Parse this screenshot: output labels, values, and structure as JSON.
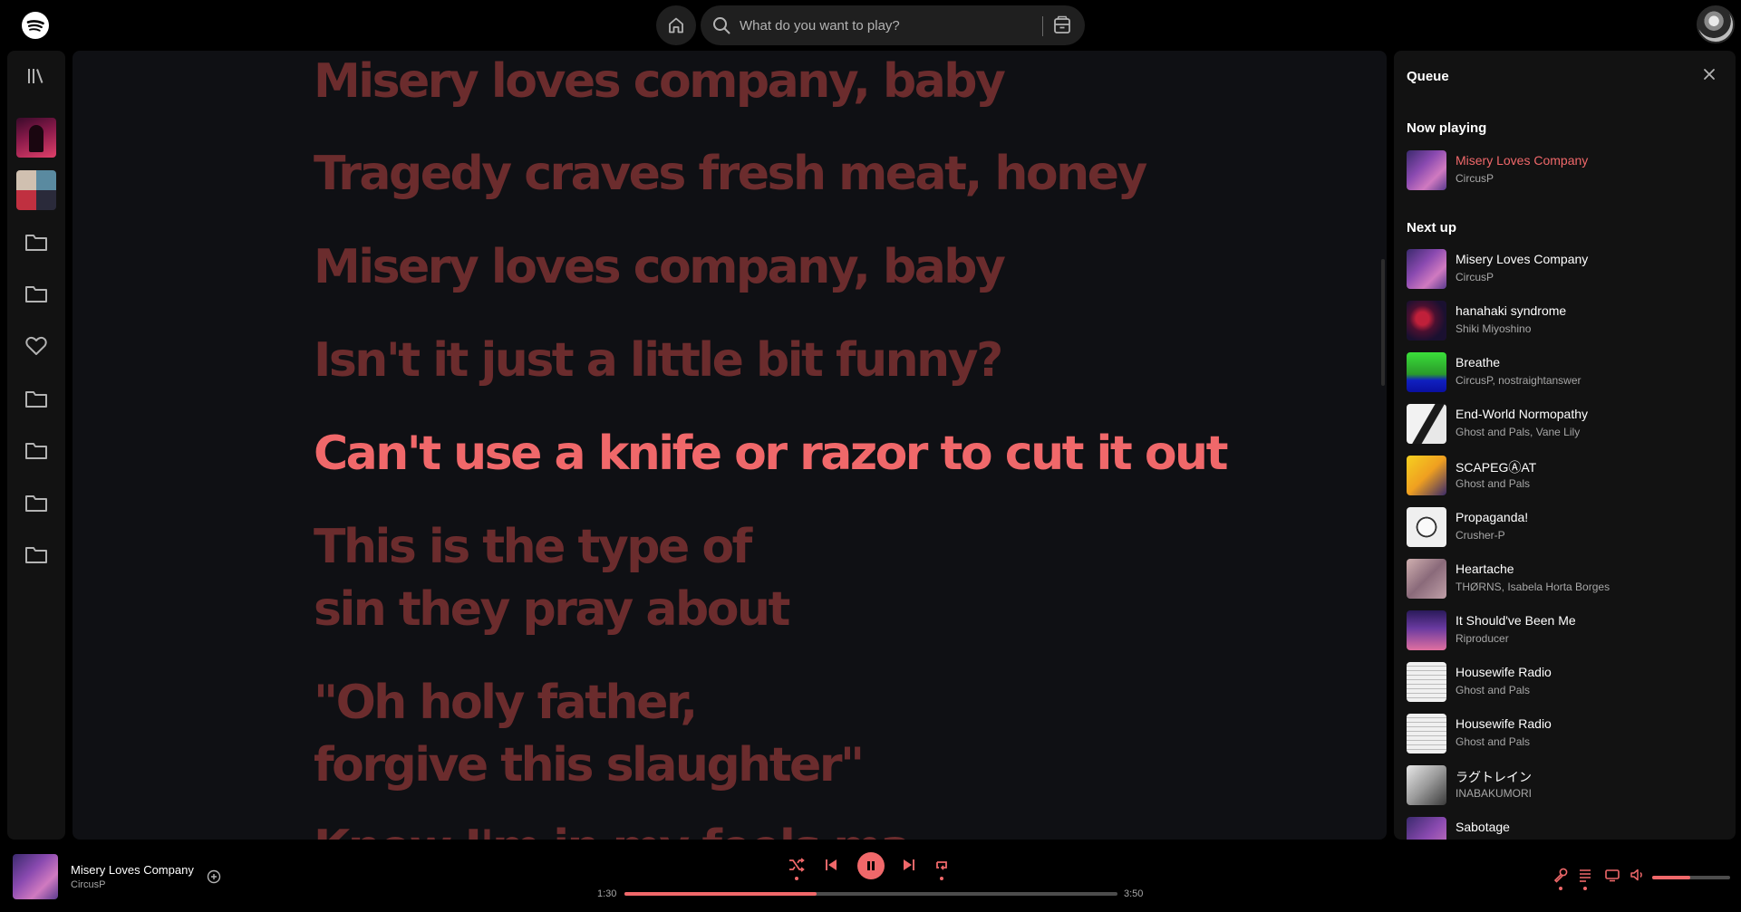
{
  "search": {
    "placeholder": "What do you want to play?"
  },
  "lyrics": {
    "lines": [
      "Misery loves company, baby",
      "Tragedy craves fresh meat, honey",
      "Misery loves company, baby",
      "Isn't it just a little bit funny?",
      "Can't use a knife or razor to cut it out",
      "This is the type of",
      "sin they pray about",
      "\"Oh holy father,",
      "forgive this slaughter\"",
      "Know I'm in my feels ma..."
    ],
    "active_index": 4
  },
  "queue": {
    "title": "Queue",
    "now_playing_label": "Now playing",
    "now_playing": {
      "title": "Misery Loves Company",
      "artist": "CircusP"
    },
    "next_up_label": "Next up",
    "next_up": [
      {
        "title": "Misery Loves Company",
        "artist": "CircusP"
      },
      {
        "title": "hanahaki syndrome",
        "artist": "Shiki Miyoshino"
      },
      {
        "title": "Breathe",
        "artist": "CircusP, nostraightanswer"
      },
      {
        "title": "End-World Normopathy",
        "artist": "Ghost and Pals, Vane Lily"
      },
      {
        "title": "SCAPEGⒶAT",
        "artist": "Ghost and Pals"
      },
      {
        "title": "Propaganda!",
        "artist": "Crusher-P"
      },
      {
        "title": "Heartache",
        "artist": "THØRNS, Isabela Horta Borges"
      },
      {
        "title": "It Should've Been Me",
        "artist": "Riproducer"
      },
      {
        "title": "Housewife Radio",
        "artist": "Ghost and Pals"
      },
      {
        "title": "Housewife Radio",
        "artist": "Ghost and Pals"
      },
      {
        "title": "ラグトレイン",
        "artist": "INABAKUMORI"
      },
      {
        "title": "Sabotage",
        "artist": ""
      }
    ]
  },
  "player": {
    "title": "Misery Loves Company",
    "artist": "CircusP",
    "elapsed": "1:30",
    "duration": "3:50",
    "progress_fraction": 0.39,
    "volume_fraction": 0.49
  },
  "colors": {
    "accent": "#f0686a",
    "lyric_inactive": "#6b2c2d",
    "panel": "#121212",
    "lyrics_bg": "#0f1014"
  }
}
